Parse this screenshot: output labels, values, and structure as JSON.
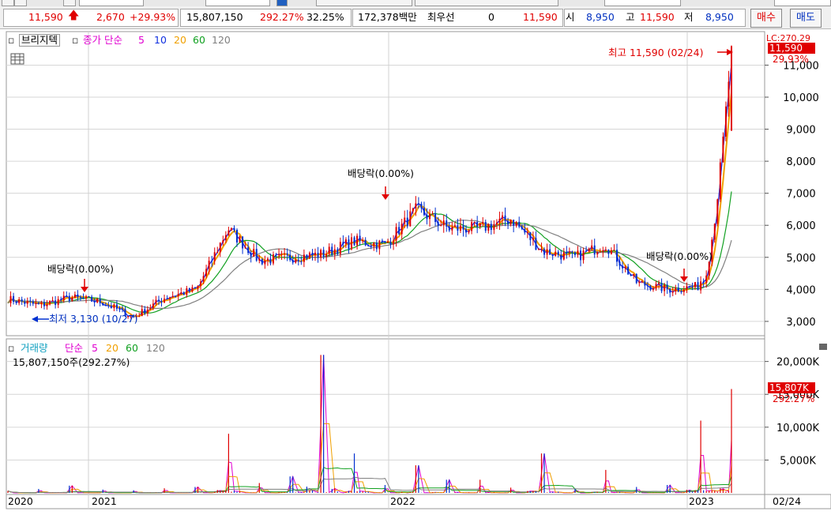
{
  "quote": {
    "price": "11,590",
    "change": "2,670",
    "change_pct": "+29.93%",
    "volume": "15,807,150",
    "volume_ratio": "292.27%",
    "turnover": "32.25%",
    "amount": "172,378백만",
    "best_bid_label": "최우선",
    "best_bid_value": "0",
    "best_price": "11,590",
    "open_label": "시",
    "open": "8,950",
    "high_label": "고",
    "high": "11,590",
    "low_label": "저",
    "low": "8,950",
    "buy_label": "매수",
    "sell_label": "매도"
  },
  "price_panel": {
    "chart_name": "브리지텍",
    "ma_label": "종가 단순",
    "ma_periods": [
      "5",
      "10",
      "20",
      "60",
      "120"
    ],
    "ma_colors": [
      "#e000d0",
      "#1030e0",
      "#f0a000",
      "#10a020",
      "#808080"
    ],
    "high_annotation": "최고 11,590 (02/24)",
    "low_annotation": "최저 3,130 (10/27)",
    "dividend_label": "배당락(0.00%)",
    "axis_ticks": [
      "11,000",
      "10,000",
      "9,000",
      "8,000",
      "7,000",
      "6,000",
      "5,000",
      "4,000",
      "3,000"
    ],
    "current_price_badge": "11,590",
    "current_pct": "29.93%",
    "lc_label": "LC:270.29"
  },
  "volume_panel": {
    "label": "거래량",
    "ma_label": "단순",
    "ma_periods": [
      "5",
      "20",
      "60",
      "120"
    ],
    "ma_colors": [
      "#e000d0",
      "#f0a000",
      "#10a020",
      "#808080"
    ],
    "current_volume": "15,807,150주(292.27%)",
    "axis_ticks": [
      "20,000K",
      "15,000K",
      "10,000K",
      "5,000K"
    ],
    "current_badge": "15,807K",
    "current_pct": "292.27%"
  },
  "x_axis": {
    "labels": [
      "2020",
      "2021",
      "2022",
      "2023"
    ],
    "last_date": "02/24"
  },
  "chart_data": {
    "type": "line",
    "title": "브리지텍",
    "x": [
      "2020-01",
      "2020-03",
      "2020-06",
      "2020-09",
      "2020-10",
      "2020-12",
      "2021-02",
      "2021-04",
      "2021-05",
      "2021-07",
      "2021-09",
      "2021-10",
      "2021-12",
      "2022-01",
      "2022-02",
      "2022-04",
      "2022-06",
      "2022-07",
      "2022-09",
      "2022-10",
      "2022-11",
      "2022-12",
      "2023-01",
      "2023-02"
    ],
    "series": [
      {
        "name": "종가",
        "values": [
          3700,
          3500,
          3750,
          3600,
          3130,
          3750,
          4000,
          5900,
          4900,
          5000,
          5100,
          5500,
          5400,
          6500,
          5900,
          5900,
          6200,
          5200,
          5000,
          5400,
          4200,
          4000,
          4100,
          11590
        ]
      }
    ],
    "volume_values_k": [
      300,
      600,
      1100,
      500,
      400,
      700,
      900,
      9000,
      1500,
      2500,
      21000,
      6000,
      1200,
      4200,
      2000,
      2000,
      800,
      6000,
      600,
      3500,
      900,
      1200,
      11000,
      15807
    ],
    "ylim": [
      2800,
      11800
    ],
    "volume_ylim": [
      0,
      22000
    ]
  }
}
